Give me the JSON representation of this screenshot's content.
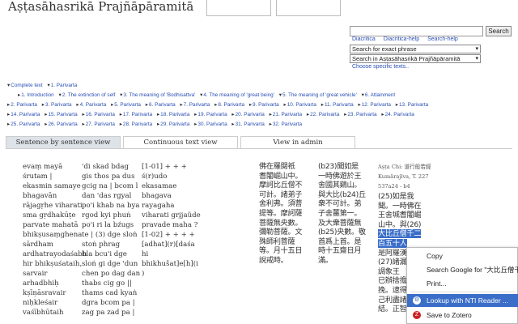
{
  "header": {
    "title": "Aṣṭasāhasrikā Prajñāpāramitā",
    "search_button": "Search",
    "links": [
      "Diacritica",
      "Diacritica-help",
      "Search-help"
    ],
    "mode_select": "Search for exact phrase",
    "scope_select": "Search in Aṣṭasāhasrikā Prajñāpāramitā",
    "suggest_link": "Choose specific texts.."
  },
  "nav": {
    "row1": [
      "Complete text",
      "1. Parivarta"
    ],
    "row2": [
      "1. Introduction",
      "2. The extinction of self",
      "3. The meaning of 'Bodhisattva'",
      "4. The meaning of 'great being'",
      "5. The meaning of 'great vehicle'",
      "6. Attainment"
    ],
    "row3": [
      "2. Parivarta",
      "3. Parivarta",
      "4. Parivarta",
      "5. Parivarta",
      "6. Parivarta",
      "7. Parivarta",
      "8. Parivarta",
      "9. Parivarta",
      "10. Parivarta",
      "11. Parivarta",
      "12. Parivarta",
      "13. Parivarta"
    ],
    "row4": [
      "14. Parivarta",
      "15. Parivarta",
      "16. Parivarta",
      "17. Parivarta",
      "18. Parivarta",
      "19. Parivarta",
      "20. Parivarta",
      "21. Parivarta",
      "22. Parivarta",
      "23. Parivarta",
      "24. Parivarta"
    ],
    "row5": [
      "25. Parivarta",
      "26. Parivarta",
      "27. Parivarta",
      "28. Parivarta",
      "29. Parivarta",
      "30. Parivarta",
      "31. Parivarta",
      "32. Parivarta"
    ]
  },
  "tabs": [
    "Sentence by sentence view",
    "Continuous text view",
    "View in admin"
  ],
  "content": {
    "sanskrit": "evaṃ mayā\nśrutam |\nekasmin samaye\nbhagavān\nrājagṛhe viharati\nsma gṛdhakūṭe\nparvate mahatā\nbhikṣusaṃghena\nsārdham\nardhatrayodaśabh\nhir bhikṣuśataih,\nsarvair\narhadbhiḥ\nkṣīṇāsravair\nniḥkleśair\nvaśībhūtaih",
    "tibetan": "'di skad bdag\ngis thos pa dus\ngcig na | bcom l\ndan 'das rgyal\npo'i khab na bya\nrgod kyi phuṅ\npo'i ri la bźugs\nte | (3) dge sloṅ\nstoṅ phrag\nbla bcu'i dge\nsloṅ gi dge 'dun\nchen po dag dan\nthabs cig go ||\nthams cad kyaṅ\ndgra bcom pa |\nzag pa zad pa |",
    "notes": "[1-01] + + +\nś(r)udo\nekasamae\nbhagava\nrayagaha\nviharati gri̧jaüde\npravade maha ?\n[1-02] + + + +\n[adhat](r)[daśa\nhi\nbhikhušat]e[h](i\n)",
    "chinese1": "佛在羅閱祇\n耆闍崛山中。\n摩訶比丘僧不\n可計。諸弟子\n舍利弗。須菩\n提等。摩訶薩\n菩薩無央數。\n彌勒菩薩。文\n殊師利菩薩\n等。月十五日\n說戒時。",
    "chinese2": "(b23)聞如是\n一時佛遊於王\n舍國其鷄山。\n與大比(b24)丘\n衆不可計。弟\n子舍薑第一。\n及大衆菩薩無\n(b25)央數。敬\n首爲上首。是\n時十五齋日月\n滿。",
    "asta_ref": "Aṣṭa Chi: 道行般若經\nKumārajīva, T. 227\n537a24 - b4",
    "chinese3a": "(25)如是我\n聞。一時佛在\n王舍城耆闍崛\n山中。與(26)",
    "chinese3b": "大比丘僧千二\n百五十人",
    "chinese3c": "是阿羅漢\n(27)諸漏已\n調象王\n已辦捨擔\n挽。逮得\n己利盡諸\n結。正智"
  },
  "context_menu": {
    "items": [
      "Copy",
      "Search Google for \"大比丘僧千二百五十人\"",
      "Print...",
      "Lookup with NTI Reader ...",
      "Save to Zotero"
    ],
    "highlighted_index": 3
  },
  "colors": {
    "link": "#2a4fb5",
    "tab_active": "#dde3e8",
    "highlight": "#3a6ec8"
  }
}
